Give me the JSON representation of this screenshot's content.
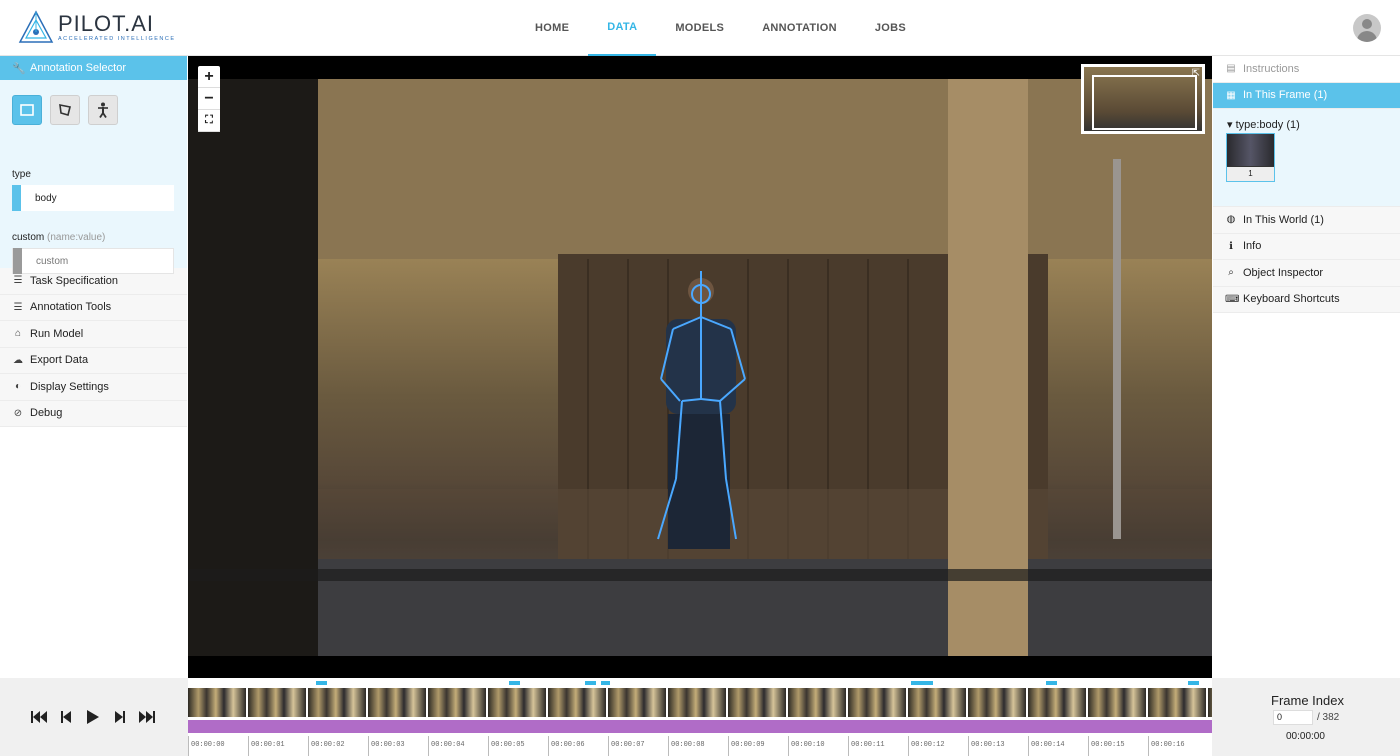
{
  "brand": {
    "name": "PILOT.AI",
    "tagline": "ACCELERATED INTELLIGENCE"
  },
  "nav": [
    {
      "label": "HOME",
      "active": false
    },
    {
      "label": "DATA",
      "active": true
    },
    {
      "label": "MODELS",
      "active": false
    },
    {
      "label": "ANNOTATION",
      "active": false
    },
    {
      "label": "JOBS",
      "active": false
    }
  ],
  "left_panel": {
    "header": "Annotation Selector",
    "tools": [
      "rectangle-tool",
      "polygon-tool",
      "skeleton-tool"
    ],
    "type_label": "type",
    "type_value": "body",
    "custom_label": "custom",
    "custom_hint": "(name:value)",
    "custom_placeholder": "custom",
    "menu": [
      {
        "label": "Task Specification",
        "icon": "list-icon"
      },
      {
        "label": "Annotation Tools",
        "icon": "list-icon"
      },
      {
        "label": "Run Model",
        "icon": "run-icon"
      },
      {
        "label": "Export Data",
        "icon": "cloud-icon"
      },
      {
        "label": "Display Settings",
        "icon": "toggle-icon"
      },
      {
        "label": "Debug",
        "icon": "debug-icon"
      }
    ]
  },
  "viewer": {
    "zoom_in": "+",
    "zoom_out": "−",
    "fit": "⛶"
  },
  "right_panel": {
    "instructions": "Instructions",
    "in_this_frame": "In This Frame (1)",
    "group_label": "type:body (1)",
    "thumb_index": "1",
    "in_this_world": "In This World (1)",
    "info": "Info",
    "object_inspector": "Object Inspector",
    "keyboard_shortcuts": "Keyboard Shortcuts"
  },
  "timeline": {
    "timestamps": [
      "00:00:00",
      "00:00:01",
      "00:00:02",
      "00:00:03",
      "00:00:04",
      "00:00:05",
      "00:00:06",
      "00:00:07",
      "00:00:08",
      "00:00:09",
      "00:00:10",
      "00:00:11",
      "00:00:12",
      "00:00:13",
      "00:00:14",
      "00:00:15",
      "00:00:16"
    ],
    "track_color": "#b06cc7"
  },
  "frame_index": {
    "title": "Frame Index",
    "value": "0",
    "total": "/ 382",
    "time": "00:00:00"
  },
  "colors": {
    "accent": "#5bc2ea",
    "nav_active": "#35b6e6",
    "skeleton": "#4aa8ff"
  }
}
